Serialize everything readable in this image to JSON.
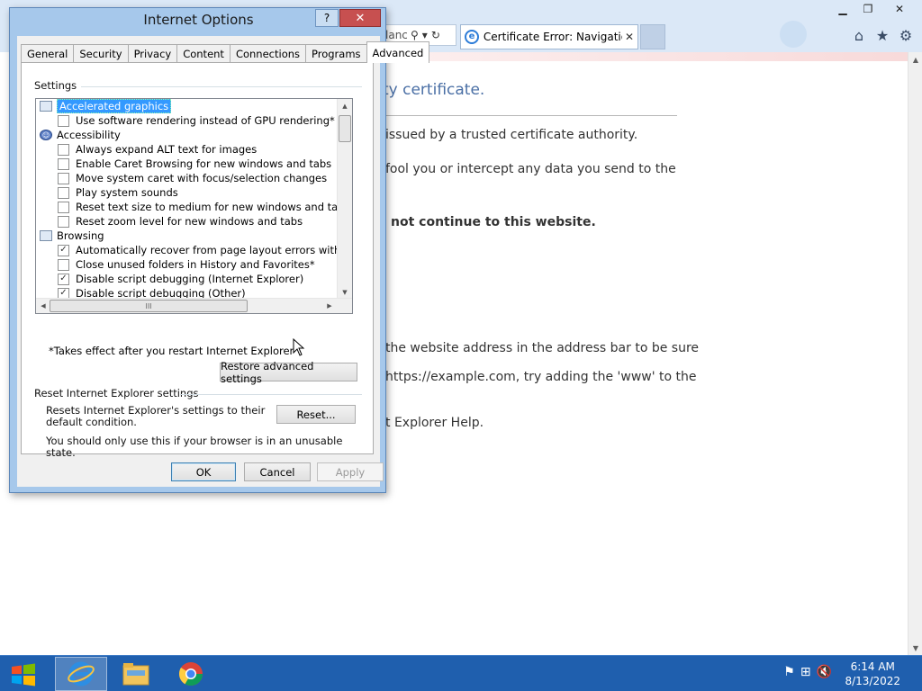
{
  "browser": {
    "address_fragment": "lanc",
    "active_tab_title": "Certificate Error: Navigation...",
    "page": {
      "heading": "ty certificate.",
      "lines": [
        "issued by a trusted certificate authority.",
        "fool you or intercept any data you send to the",
        "not continue to this website.",
        "the website address in the address bar to be sure",
        "https://example.com, try adding the 'www' to the",
        "t Explorer Help."
      ]
    }
  },
  "dialog": {
    "title": "Internet Options",
    "help_label": "?",
    "close_label": "✕",
    "tabs": [
      "General",
      "Security",
      "Privacy",
      "Content",
      "Connections",
      "Programs",
      "Advanced"
    ],
    "active_tab": "Advanced",
    "settings_group_label": "Settings",
    "settings": [
      {
        "type": "category",
        "label": "Accelerated graphics",
        "selected": true
      },
      {
        "type": "option",
        "label": "Use software rendering instead of GPU rendering*",
        "checked": false
      },
      {
        "type": "category",
        "label": "Accessibility",
        "selected": false
      },
      {
        "type": "option",
        "label": "Always expand ALT text for images",
        "checked": false
      },
      {
        "type": "option",
        "label": "Enable Caret Browsing for new windows and tabs",
        "checked": false
      },
      {
        "type": "option",
        "label": "Move system caret with focus/selection changes",
        "checked": false
      },
      {
        "type": "option",
        "label": "Play system sounds",
        "checked": false
      },
      {
        "type": "option",
        "label": "Reset text size to medium for new windows and tabs",
        "checked": false
      },
      {
        "type": "option",
        "label": "Reset zoom level for new windows and tabs",
        "checked": false
      },
      {
        "type": "category",
        "label": "Browsing",
        "selected": false
      },
      {
        "type": "option",
        "label": "Automatically recover from page layout errors with Compa",
        "checked": true
      },
      {
        "type": "option",
        "label": "Close unused folders in History and Favorites*",
        "checked": false
      },
      {
        "type": "option",
        "label": "Disable script debugging (Internet Explorer)",
        "checked": true
      },
      {
        "type": "option",
        "label": "Disable script debugging (Other)",
        "checked": true
      }
    ],
    "restart_note": "*Takes effect after you restart Internet Explorer",
    "restore_button": "Restore advanced settings",
    "reset_group_label": "Reset Internet Explorer settings",
    "reset_description": "Resets Internet Explorer's settings to their default condition.",
    "reset_button": "Reset...",
    "reset_warning": "You should only use this if your browser is in an unusable state.",
    "ok_button": "OK",
    "cancel_button": "Cancel",
    "apply_button": "Apply"
  },
  "taskbar": {
    "time": "6:14 AM",
    "date": "8/13/2022"
  },
  "icons": {
    "checked_glyph": "✓",
    "hscroll_grip": "III"
  }
}
